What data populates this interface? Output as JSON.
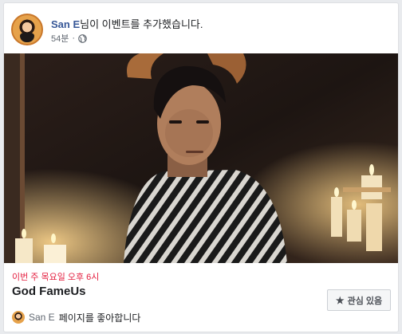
{
  "post": {
    "author_name": "San E",
    "action_text": "님이 이벤트를 추가했습니다.",
    "timestamp": "54분",
    "privacy_icon": "globe-icon"
  },
  "event": {
    "date_text": "이번 주 목요일 오후 6시",
    "title": "God FameUs",
    "interest_label": "관심 있음",
    "interest_icon": "star-icon"
  },
  "liker": {
    "name": "San E",
    "text": "페이지를 좋아합니다"
  },
  "colors": {
    "author_link": "#385898",
    "event_date": "#e41e3f",
    "card_bg": "#ffffff",
    "page_bg": "#e9ebee"
  }
}
